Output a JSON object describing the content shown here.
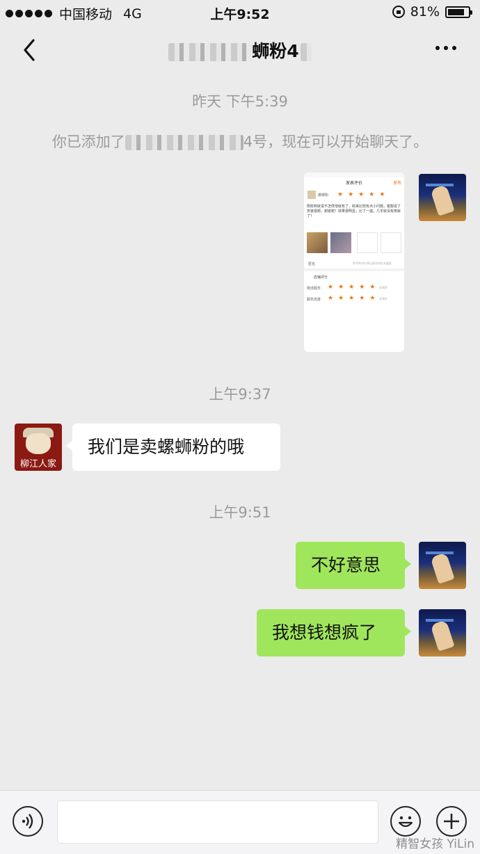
{
  "status_bar": {
    "carrier": "中国移动",
    "network": "4G",
    "time": "上午9:52",
    "battery": "81%",
    "battery_level": 0.81
  },
  "nav": {
    "title_suffix": "蛳粉4",
    "back_icon": "chevron-left-icon",
    "more_icon": "more-dots-icon"
  },
  "chat": {
    "time_1": "昨天 下午5:39",
    "system_prefix": "你已添加了",
    "system_suffix": "4号，现在可以开始聊天了。",
    "time_2": "上午9:37",
    "msg_in_1": "我们是卖螺蛳粉的哦",
    "avatar_shop_text": "柳江人家",
    "time_3": "上午9:51",
    "msg_out_1": "不好意思",
    "msg_out_2": "我想钱想疯了"
  },
  "screenshot_image": {
    "header_title": "发表评价",
    "header_action": "发布",
    "shop_name": "螺蛳粉",
    "review_text": "刚收到就说不怎样他就有了，收来比较有点小问题，客服说了安装视频，谢谢谢！效果很明显，比了一遍，几乎就没有用就了？",
    "anonymous_label": "匿名",
    "anonymous_hint": "你写的评价将以匿名的形式展现",
    "shop_rating_title": "店铺评分",
    "rating_1_label": "物流服务",
    "rating_2_label": "服务态度",
    "rating_hint": "非常好",
    "star_rating": 5
  },
  "input_bar": {
    "voice_icon": "voice-icon",
    "emoji_icon": "emoji-icon",
    "plus_icon": "plus-icon"
  },
  "watermark": "精智女孩 YiLin"
}
